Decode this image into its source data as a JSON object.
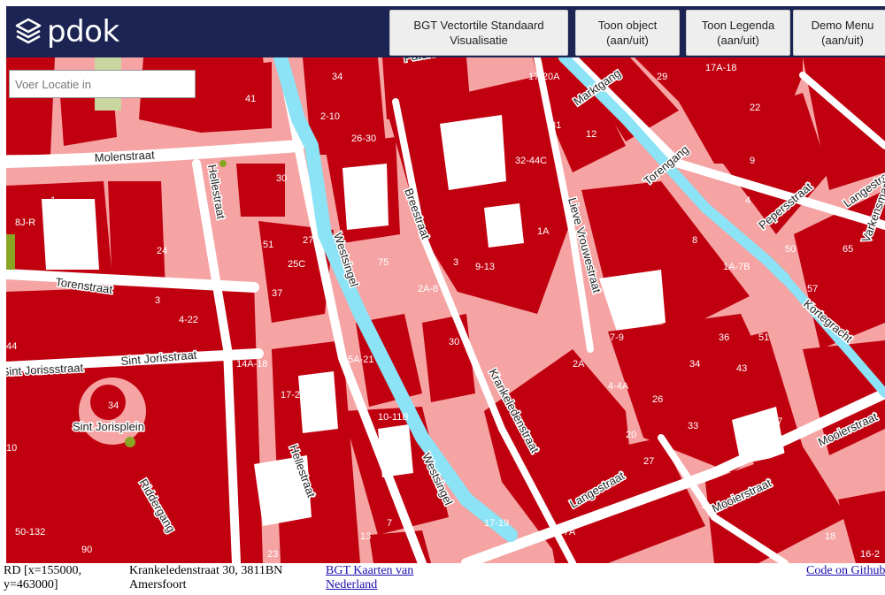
{
  "header": {
    "logo_text": "pdok",
    "buttons": [
      {
        "line1": "BGT Vectortile Standaard",
        "line2": "Visualisatie"
      },
      {
        "line1": "Toon object",
        "line2": "(aan/uit)"
      },
      {
        "line1": "Toon Legenda",
        "line2": "(aan/uit)"
      },
      {
        "line1": "Demo Menu",
        "line2": "(aan/uit)"
      }
    ]
  },
  "search": {
    "placeholder": "Voer Locatie in"
  },
  "map": {
    "colors": {
      "building": "#c0000f",
      "ground": "#f5a3a3",
      "water": "#8be3f5",
      "road": "#ffffff",
      "green": "#8aa524"
    },
    "street_labels": [
      "Molenstraat",
      "Hellestraat",
      "Torenstraat",
      "Sint Jorisstraat",
      "Sint Jorissstraat",
      "Sint Jorisplein",
      "Riddergang",
      "Westsingel",
      "Breestraat",
      "Lieve Vrouwestraat",
      "Krankeledenstraat",
      "Langestraat",
      "Marktgang",
      "Torengang",
      "Pepersstraat",
      "Langestraat",
      "Kortegracht",
      "Mooierstraat",
      "Mooierstraat",
      "Hellestraat",
      "Westsingel",
      "Paterstraat",
      "Varkensmarkt"
    ],
    "number_labels": [
      "34",
      "41",
      "2-10",
      "26-30",
      "30",
      "1",
      "8J-R",
      "24",
      "3",
      "4-22",
      "51",
      "27",
      "25C",
      "37",
      "75",
      "2A-8",
      "3",
      "9-13",
      "1A",
      "32-44C",
      "12",
      "31",
      "17-20A",
      "29",
      "17A-18",
      "22",
      "9",
      "4",
      "50",
      "1A-7B",
      "8",
      "36",
      "51",
      "43",
      "34",
      "26",
      "7-9",
      "2A",
      "4-4A",
      "20",
      "33",
      "27",
      "17",
      "13",
      "7",
      "17-19",
      "7-7A",
      "5",
      "23",
      "90",
      "50-132",
      "10-11B",
      "17-23",
      "15A-21",
      "14A-18",
      "44",
      "10",
      "34",
      "57",
      "65",
      "18",
      "16-2",
      "30"
    ]
  },
  "footer": {
    "rd": "RD [x=155000, y=463000]",
    "address": "Krankeledenstraat 30, 3811BN Amersfoort",
    "link1": "BGT Kaarten van Nederland",
    "link2": "Code on Github"
  }
}
